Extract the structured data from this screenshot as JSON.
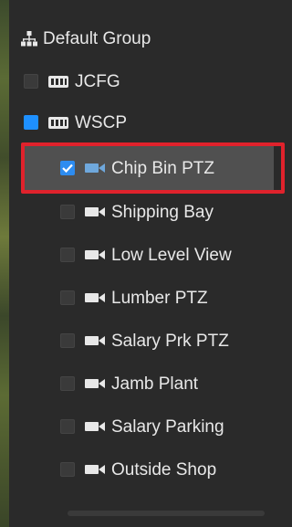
{
  "tree": {
    "root": {
      "label": "Default Group",
      "icon": "hierarchy-icon"
    },
    "groups": [
      {
        "label": "JCFG",
        "icon": "nvr-device-icon",
        "checked": false
      },
      {
        "label": "WSCP",
        "icon": "nvr-device-icon",
        "checked": "partial"
      }
    ],
    "cameras": [
      {
        "label": "Chip Bin PTZ",
        "icon": "camera-icon",
        "checked": true,
        "selected": true
      },
      {
        "label": "Shipping Bay",
        "icon": "camera-icon",
        "checked": false
      },
      {
        "label": "Low Level View",
        "icon": "camera-icon",
        "checked": false
      },
      {
        "label": "Lumber PTZ",
        "icon": "camera-icon",
        "checked": false
      },
      {
        "label": "Salary Prk PTZ",
        "icon": "camera-icon",
        "checked": false
      },
      {
        "label": "Jamb Plant",
        "icon": "camera-icon",
        "checked": false
      },
      {
        "label": "Salary Parking",
        "icon": "camera-icon",
        "checked": false
      },
      {
        "label": "Outside Shop",
        "icon": "camera-icon",
        "checked": false
      }
    ]
  },
  "colors": {
    "background": "#2a2a2a",
    "selected_row": "#505050",
    "highlight_border": "#e0222c",
    "checkbox_checked": "#2d8cf0",
    "checkbox_partial": "#1e90ff",
    "camera_icon": "#6fa8dc"
  }
}
